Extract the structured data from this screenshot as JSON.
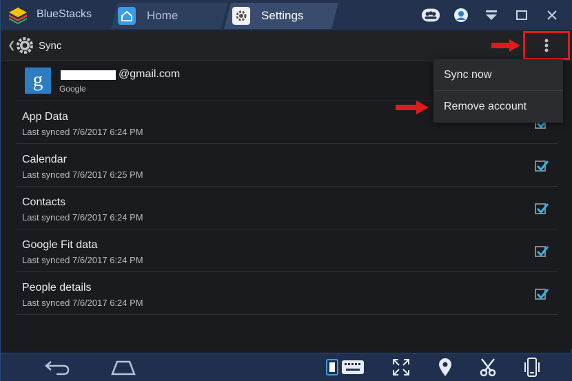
{
  "titlebar": {
    "app_name": "BlueStacks",
    "tabs": [
      {
        "label": "Home",
        "icon": "home-icon"
      },
      {
        "label": "Settings",
        "icon": "gear-icon"
      }
    ],
    "controls": [
      "multi-user-icon",
      "account-circle-icon",
      "dropdown-icon",
      "maximize-icon",
      "close-icon"
    ]
  },
  "actionbar": {
    "title": "Sync",
    "overflow_icon": "more-vert-icon"
  },
  "account": {
    "email_suffix": "@gmail.com",
    "type": "Google",
    "logo_letter": "g"
  },
  "sync_items": [
    {
      "title": "App Data",
      "last_synced": "Last synced 7/6/2017 6:24 PM",
      "checked": true
    },
    {
      "title": "Calendar",
      "last_synced": "Last synced 7/6/2017 6:25 PM",
      "checked": true
    },
    {
      "title": "Contacts",
      "last_synced": "Last synced 7/6/2017 6:24 PM",
      "checked": true
    },
    {
      "title": "Google Fit data",
      "last_synced": "Last synced 7/6/2017 6:24 PM",
      "checked": true
    },
    {
      "title": "People details",
      "last_synced": "Last synced 7/6/2017 6:24 PM",
      "checked": true
    }
  ],
  "menu": {
    "items": [
      "Sync now",
      "Remove account"
    ]
  },
  "colors": {
    "titlebar": "#22324f",
    "accent_check": "#33b5e5",
    "annotation_red": "#e01b1b"
  },
  "navbar": {
    "buttons": [
      "back-icon",
      "home-icon",
      "keyboard-toggle-icon",
      "fullscreen-icon",
      "location-icon",
      "scissors-icon",
      "shake-phone-icon"
    ]
  }
}
